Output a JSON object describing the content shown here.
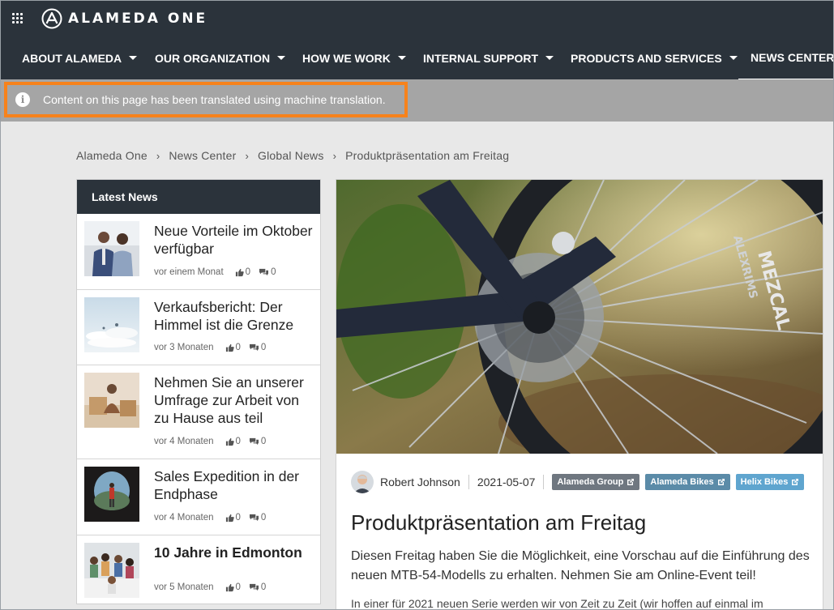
{
  "app": {
    "name": "ALAMEDA ONE"
  },
  "nav": {
    "items": [
      {
        "label": "ABOUT ALAMEDA",
        "dropdown": true
      },
      {
        "label": "OUR ORGANIZATION",
        "dropdown": true
      },
      {
        "label": "HOW WE WORK",
        "dropdown": true
      },
      {
        "label": "INTERNAL SUPPORT",
        "dropdown": true
      },
      {
        "label": "PRODUCTS AND SERVICES",
        "dropdown": true
      },
      {
        "label": "NEWS CENTER",
        "dropdown": false,
        "active": true
      }
    ]
  },
  "banner": {
    "text": "Content on this page has been translated using machine translation.",
    "icon": "info-icon"
  },
  "breadcrumb": [
    "Alameda One",
    "News Center",
    "Global News",
    "Produktpräsentation am Freitag"
  ],
  "latest_news": {
    "title": "Latest News",
    "items": [
      {
        "title": "Neue Vorteile im Oktober verfügbar",
        "time": "vor einem Monat",
        "likes": "0",
        "comments": "0",
        "bold": false
      },
      {
        "title": "Verkaufsbericht: Der Himmel ist die Grenze",
        "time": "vor 3 Monaten",
        "likes": "0",
        "comments": "0",
        "bold": false
      },
      {
        "title": "Nehmen Sie an unserer Umfrage zur Arbeit von zu Hause aus teil",
        "time": "vor 4 Monaten",
        "likes": "0",
        "comments": "0",
        "bold": false
      },
      {
        "title": "Sales Expedition in der Endphase",
        "time": "vor 4 Monaten",
        "likes": "0",
        "comments": "0",
        "bold": false
      },
      {
        "title": "10 Jahre in Edmonton",
        "time": "vor 5 Monaten",
        "likes": "0",
        "comments": "0",
        "bold": true
      }
    ]
  },
  "article": {
    "author": "Robert Johnson",
    "date": "2021-05-07",
    "tags": [
      {
        "label": "Alameda Group",
        "color": "#6f7780"
      },
      {
        "label": "Alameda Bikes",
        "color": "#5b8ba8"
      },
      {
        "label": "Helix Bikes",
        "color": "#5fa5cf"
      }
    ],
    "title": "Produktpräsentation am Freitag",
    "lead": "Diesen Freitag haben Sie die Möglichkeit, eine Vorschau auf die Einführung des neuen MTB-54-Modells zu erhalten. Nehmen Sie am Online-Event teil!",
    "body": "In einer für 2021 neuen Serie werden wir von Zeit zu Zeit (wir hoffen auf einmal im"
  },
  "colors": {
    "header": "#2b333b",
    "banner": "#a5a5a5",
    "highlight": "#f7821b"
  }
}
